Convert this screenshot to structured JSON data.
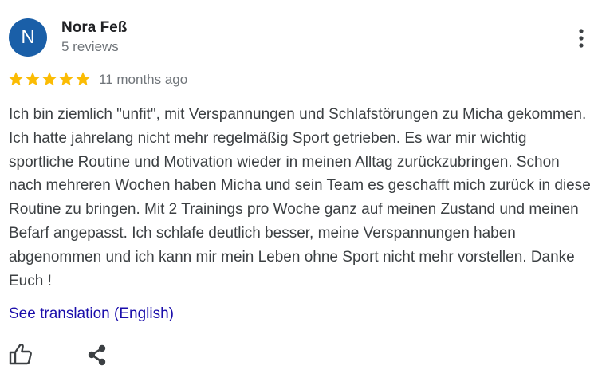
{
  "reviewer": {
    "initial": "N",
    "name": "Nora Feß",
    "review_count": "5 reviews",
    "avatar_color": "#1a5fa8"
  },
  "rating": {
    "stars": 5,
    "max": 5,
    "star_color": "#fbbc04"
  },
  "review": {
    "time": "11 months ago",
    "text": "Ich bin ziemlich \"unfit\", mit Verspannungen und Schlafstörungen zu Micha gekommen. Ich hatte jahrelang nicht mehr regelmäßig Sport getrieben. Es war mir wichtig sportliche Routine und Motivation wieder in meinen Alltag zurückzubringen. Schon nach mehreren Wochen haben Micha und sein Team es geschafft mich zurück in diese Routine zu bringen. Mit 2 Trainings pro Woche ganz auf meinen Zustand und meinen Befarf angepasst. Ich schlafe deutlich besser, meine Verspannungen haben abgenommen und ich kann mir mein Leben ohne Sport nicht mehr vorstellen. Danke Euch !",
    "translation_link": "See translation (English)"
  },
  "actions": {
    "more_icon": "more-vert-icon",
    "like_icon": "thumbs-up-icon",
    "share_icon": "share-icon",
    "icon_color": "#3c4043"
  }
}
